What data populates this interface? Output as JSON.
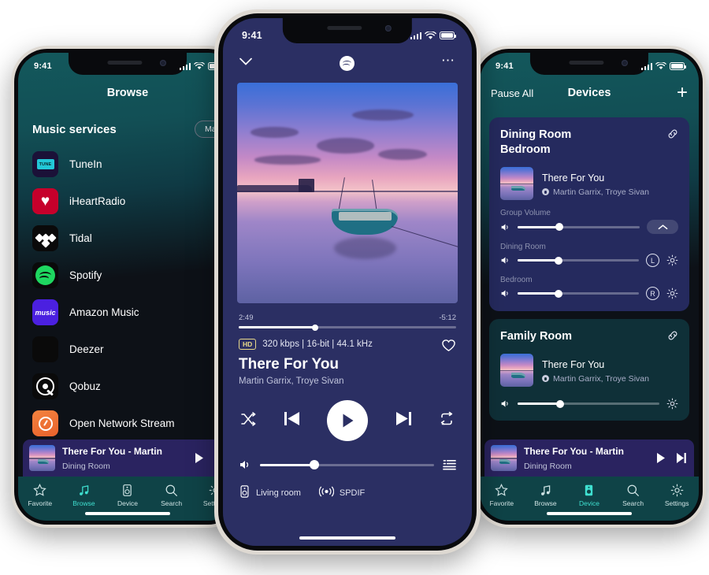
{
  "status_bar": {
    "time": "9:41",
    "signal_icon": "cellular-bars-icon",
    "wifi_icon": "wifi-icon",
    "battery_icon": "battery-icon"
  },
  "left_phone": {
    "nav_title": "Browse",
    "section": {
      "title": "Music services",
      "manage_label": "Manage"
    },
    "services": [
      {
        "label": "TuneIn",
        "icon": "tunein-icon",
        "mark": "TUNE"
      },
      {
        "label": "iHeartRadio",
        "icon": "iheartradio-icon",
        "mark": ""
      },
      {
        "label": "Tidal",
        "icon": "tidal-icon",
        "mark": ""
      },
      {
        "label": "Spotify",
        "icon": "spotify-icon",
        "mark": ""
      },
      {
        "label": "Amazon Music",
        "icon": "amazon-music-icon",
        "mark": "music"
      },
      {
        "label": "Deezer",
        "icon": "deezer-icon",
        "mark": ""
      },
      {
        "label": "Qobuz",
        "icon": "qobuz-icon",
        "mark": ""
      },
      {
        "label": "Open Network Stream",
        "icon": "network-stream-icon",
        "mark": ""
      }
    ],
    "mini_player": {
      "title": "There For You - Martin",
      "room": "Dining Room",
      "play_icon": "play-icon",
      "next_icon": "next-track-icon",
      "progress_pct": 56
    },
    "tabs": [
      {
        "label": "Favorite",
        "icon": "star-icon",
        "active": false
      },
      {
        "label": "Browse",
        "icon": "music-note-icon",
        "active": true
      },
      {
        "label": "Device",
        "icon": "speaker-icon",
        "active": false
      },
      {
        "label": "Search",
        "icon": "search-icon",
        "active": false
      },
      {
        "label": "Settings",
        "icon": "gear-icon",
        "active": false
      }
    ]
  },
  "center_phone": {
    "header": {
      "collapse_icon": "chevron-down-icon",
      "source_icon": "spotify-logo-icon",
      "more_icon": "more-options-icon"
    },
    "album_art_alt": "sunset-lake-boat-artwork",
    "elapsed": "2:49",
    "remaining": "-5:12",
    "progress_pct": 35,
    "quality_badge": "HD",
    "quality_text": "320 kbps | 16-bit | 44.1 kHz",
    "title": "There For You",
    "artist": "Martin Garrix, Troye Sivan",
    "favorite_icon": "heart-outline-icon",
    "transport": {
      "shuffle_icon": "shuffle-icon",
      "previous_icon": "previous-track-icon",
      "play_icon": "play-icon",
      "next_icon": "next-track-icon",
      "repeat_icon": "repeat-icon"
    },
    "volume": {
      "icon": "volume-icon",
      "level_pct": 31,
      "queue_icon": "queue-list-icon"
    },
    "footer": {
      "room": "Living room",
      "room_icon": "speaker-icon",
      "output": "SPDIF",
      "output_icon": "broadcast-icon"
    }
  },
  "right_phone": {
    "nav_left": "Pause All",
    "nav_title": "Devices",
    "nav_right": "+",
    "cards": [
      {
        "id": "group-card",
        "theme": "indigo",
        "title_lines": [
          "Dining Room",
          "Bedroom"
        ],
        "link_icon": "link-icon",
        "now_playing": {
          "title": "There For You",
          "artist": "Martin Garrix, Troye Sivan"
        },
        "sliders": [
          {
            "label": "Group Volume",
            "level_pct": 34,
            "control": "collapse-chevron",
            "badge": ""
          },
          {
            "label": "Dining Room",
            "level_pct": 34,
            "control": "gear",
            "badge": "L"
          },
          {
            "label": "Bedroom",
            "level_pct": 34,
            "control": "gear",
            "badge": "R"
          }
        ]
      },
      {
        "id": "family-room-card",
        "theme": "teal",
        "title_lines": [
          "Family Room"
        ],
        "link_icon": "link-icon",
        "now_playing": {
          "title": "There For You",
          "artist": "Martin Garrix, Troye Sivan"
        },
        "sliders": [
          {
            "label": "",
            "level_pct": 30,
            "control": "gear",
            "badge": ""
          }
        ]
      }
    ],
    "mini_player": {
      "title": "There For You - Martin",
      "room": "Dining Room",
      "play_icon": "play-icon",
      "next_icon": "next-track-icon",
      "progress_pct": 56
    },
    "tabs": [
      {
        "label": "Favorite",
        "icon": "star-icon",
        "active": false
      },
      {
        "label": "Browse",
        "icon": "music-note-icon",
        "active": false
      },
      {
        "label": "Device",
        "icon": "speaker-icon",
        "active": true
      },
      {
        "label": "Search",
        "icon": "search-icon",
        "active": false
      },
      {
        "label": "Settings",
        "icon": "gear-icon",
        "active": false
      }
    ]
  },
  "colors": {
    "teal_header": "#13585c",
    "dark_bg": "#0d1117",
    "player_bg": "#2b2f63",
    "indigo_card": "#252a5e",
    "teal_card": "#0f3038",
    "accent_tab": "#3fe0d0",
    "tabbar": "#0f4347",
    "hd_gold": "#e8d98a"
  }
}
